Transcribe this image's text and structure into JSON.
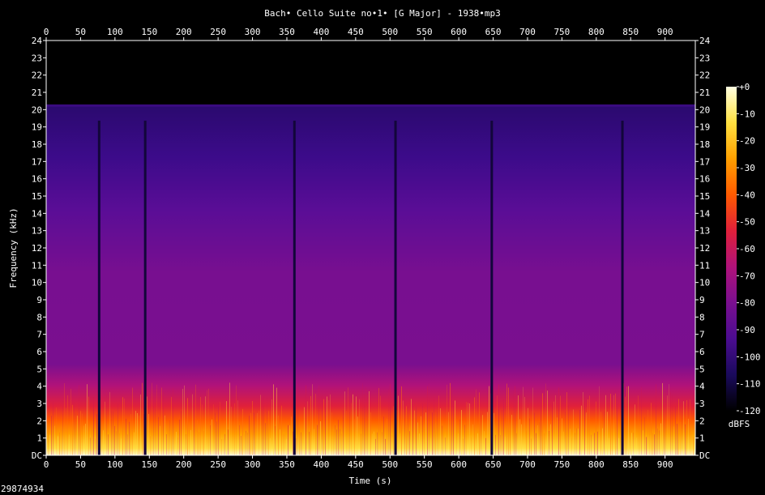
{
  "chart_data": {
    "type": "heatmap",
    "title": "Bach• Cello Suite no•1• [G Major] - 1938•mp3",
    "xlabel": "Time (s)",
    "ylabel": "Frequency (kHz)",
    "xlim": [
      0,
      944
    ],
    "ylim": [
      0,
      24
    ],
    "x_ticks": [
      "0",
      "50",
      "100",
      "150",
      "200",
      "250",
      "300",
      "350",
      "400",
      "450",
      "500",
      "550",
      "600",
      "650",
      "700",
      "750",
      "800",
      "850",
      "900"
    ],
    "y_ticks": [
      "DC",
      "1",
      "2",
      "3",
      "4",
      "5",
      "6",
      "7",
      "8",
      "9",
      "10",
      "11",
      "12",
      "13",
      "14",
      "15",
      "16",
      "17",
      "18",
      "19",
      "20",
      "21",
      "22",
      "23",
      "24"
    ],
    "frequency_cutoff_khz": 20.3,
    "silence_times_s": [
      77,
      144,
      361,
      508,
      648,
      838
    ],
    "colorbar": {
      "label": "dBFS",
      "ticks": [
        "+0",
        "-10",
        "-20",
        "-30",
        "-40",
        "-50",
        "-60",
        "-70",
        "-80",
        "-90",
        "-100",
        "-110",
        "-120"
      ],
      "range": [
        -120,
        0
      ],
      "colormap": [
        "#000000",
        "#1a0a5c",
        "#4b0c91",
        "#7a0f8f",
        "#b0127a",
        "#e0203a",
        "#ff5a00",
        "#ffa000",
        "#ffe040",
        "#ffffe0"
      ]
    },
    "corner_label": "29874934"
  }
}
